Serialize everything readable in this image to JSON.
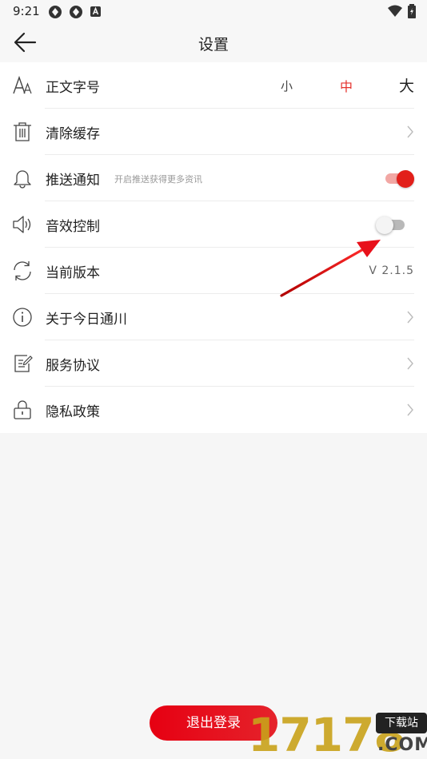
{
  "status_bar": {
    "time": "9:21"
  },
  "header": {
    "title": "设置"
  },
  "settings": {
    "font_size": {
      "label": "正文字号",
      "options": [
        "小",
        "中",
        "大"
      ],
      "selected": "中"
    },
    "clear_cache": {
      "label": "清除缓存"
    },
    "push": {
      "label": "推送通知",
      "sublabel": "开启推送获得更多资讯",
      "enabled": true
    },
    "sound": {
      "label": "音效控制",
      "enabled": false
    },
    "version": {
      "label": "当前版本",
      "value": "V 2.1.5"
    },
    "about": {
      "label": "关于今日通川"
    },
    "agreement": {
      "label": "服务协议"
    },
    "privacy": {
      "label": "隐私政策"
    }
  },
  "logout_label": "退出登录",
  "watermark": {
    "digits": "17178",
    "badge": "下载站",
    "domain": ".COM"
  },
  "colors": {
    "accent": "#e21f1a",
    "background": "#f6f6f6",
    "card": "#ffffff"
  }
}
